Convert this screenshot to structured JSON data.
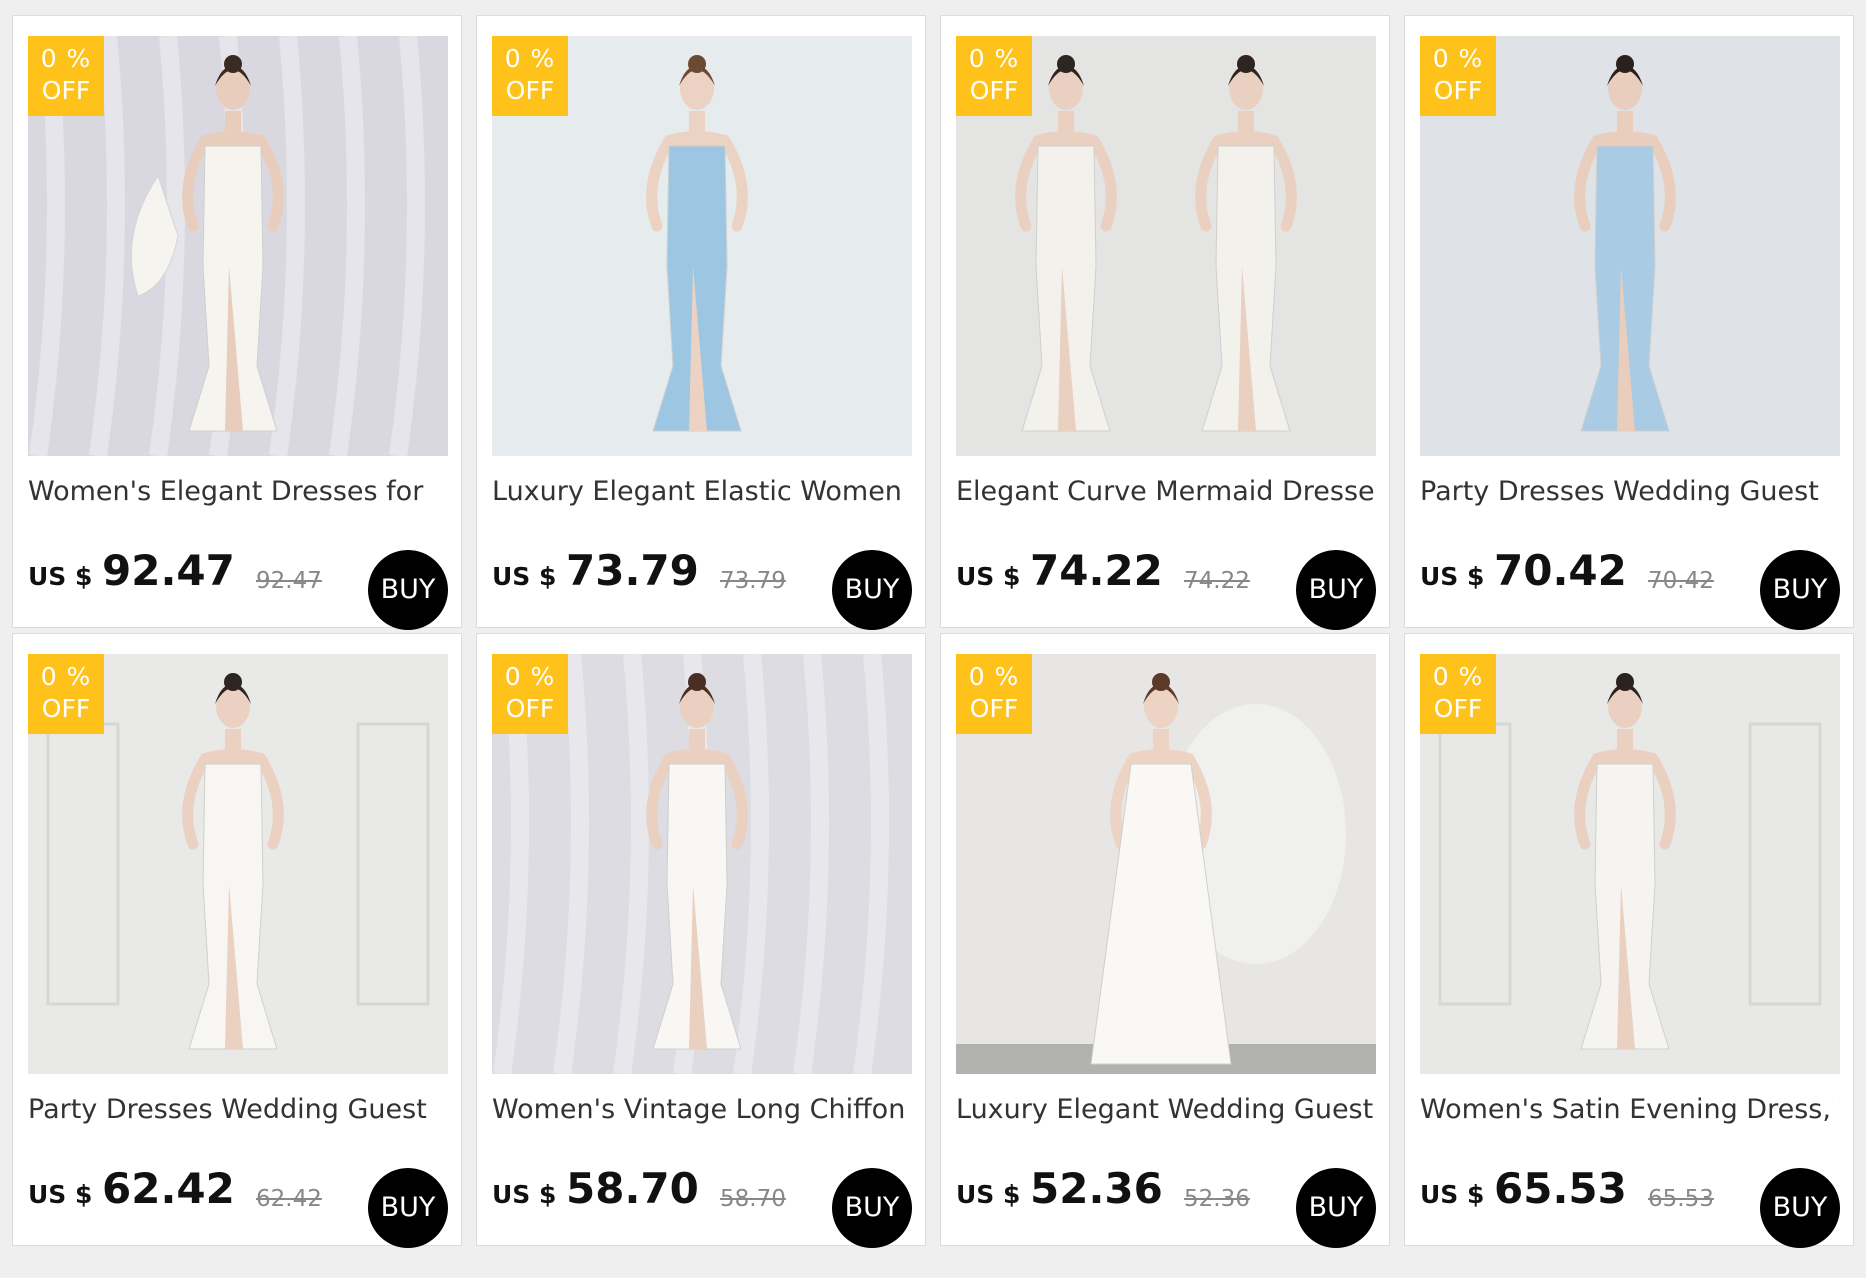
{
  "products": [
    {
      "title": "Women's Elegant Dresses for",
      "discount_pct": "0 %",
      "discount_off": "OFF",
      "currency": "US $",
      "price": "92.47",
      "old_price": "92.47",
      "buy_label": "BUY",
      "image": {
        "bg": "#d9d8e0",
        "dress": "#f6f4ef",
        "skin": "#e8cdbd",
        "hair": "#3a2a22",
        "style": "slit-gown-cape"
      }
    },
    {
      "title": "Luxury Elegant Elastic Women",
      "discount_pct": "0 %",
      "discount_off": "OFF",
      "currency": "US $",
      "price": "73.79",
      "old_price": "73.79",
      "buy_label": "BUY",
      "image": {
        "bg": "#e6ebee",
        "dress": "#9cc6e2",
        "skin": "#ecd2c3",
        "hair": "#6b4a34",
        "style": "one-shoulder-mermaid"
      }
    },
    {
      "title": "Elegant Curve Mermaid Dresses",
      "discount_pct": "0 %",
      "discount_off": "OFF",
      "currency": "US $",
      "price": "74.22",
      "old_price": "74.22",
      "buy_label": "BUY",
      "image": {
        "bg": "#e4e4e2",
        "dress": "#f2f1ec",
        "skin": "#ead0c0",
        "hair": "#2e2420",
        "style": "lace-mermaid-front-back"
      }
    },
    {
      "title": "Party Dresses Wedding Guest",
      "discount_pct": "0 %",
      "discount_off": "OFF",
      "currency": "US $",
      "price": "70.42",
      "old_price": "70.42",
      "buy_label": "BUY",
      "image": {
        "bg": "#dfe3e8",
        "dress": "#a9cbe3",
        "skin": "#e9cdbd",
        "hair": "#2a201c",
        "style": "one-shoulder-cutout"
      }
    },
    {
      "title": "Party Dresses Wedding Guest",
      "discount_pct": "0 %",
      "discount_off": "OFF",
      "currency": "US $",
      "price": "62.42",
      "old_price": "62.42",
      "buy_label": "BUY",
      "image": {
        "bg": "#e9e9e7",
        "dress": "#f7f6f2",
        "skin": "#ebd1c1",
        "hair": "#2e2420",
        "style": "off-shoulder-slit"
      }
    },
    {
      "title": "Women's Vintage Long Chiffon",
      "discount_pct": "0 %",
      "discount_off": "OFF",
      "currency": "US $",
      "price": "58.70",
      "old_price": "58.70",
      "buy_label": "BUY",
      "image": {
        "bg": "#dcdce2",
        "dress": "#f8f7f3",
        "skin": "#ead0c1",
        "hair": "#4a2e24",
        "style": "ruffle-mermaid"
      }
    },
    {
      "title": "Luxury Elegant Wedding Guest",
      "discount_pct": "0 %",
      "discount_off": "OFF",
      "currency": "US $",
      "price": "52.36",
      "old_price": "52.36",
      "buy_label": "BUY",
      "image": {
        "bg": "#e7e6e4",
        "dress": "#f9f8f5",
        "skin": "#ecd3c4",
        "hair": "#5b3b28",
        "style": "off-shoulder-aline"
      }
    },
    {
      "title": "Women's Satin Evening Dress, V",
      "discount_pct": "0 %",
      "discount_off": "OFF",
      "currency": "US $",
      "price": "65.53",
      "old_price": "65.53",
      "buy_label": "BUY",
      "image": {
        "bg": "#e8e8e6",
        "dress": "#f5f4f0",
        "skin": "#ead0c0",
        "hair": "#2b221e",
        "style": "v-neck-slit"
      }
    }
  ]
}
